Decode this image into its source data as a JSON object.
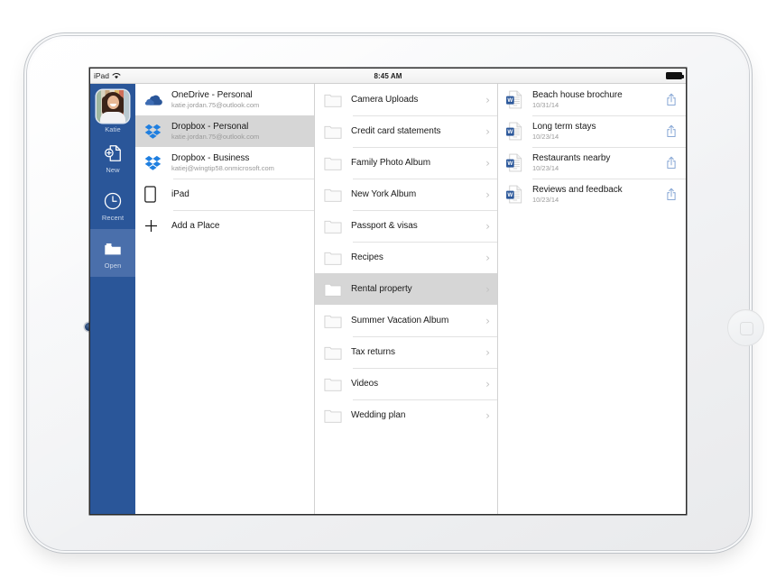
{
  "device": {
    "name": "ipad-landscape",
    "home_button": "home-button",
    "camera": "front-camera"
  },
  "statusbar": {
    "carrier": "iPad",
    "wifi_icon": "wifi-icon",
    "time": "8:45 AM",
    "battery_icon": "battery-full-icon"
  },
  "sidebar": {
    "accent": "#2a5699",
    "active_accent": "#4a6fab",
    "user": {
      "name": "Katie",
      "avatar": "user-avatar"
    },
    "items": [
      {
        "label": "New",
        "icon": "new-document-icon",
        "active": false
      },
      {
        "label": "Recent",
        "icon": "clock-icon",
        "active": false
      },
      {
        "label": "Open",
        "icon": "folder-open-icon",
        "active": true
      }
    ]
  },
  "places": {
    "items": [
      {
        "title": "OneDrive - Personal",
        "subtitle": "katie.jordan.75@outlook.com",
        "icon": "onedrive-icon",
        "selected": false
      },
      {
        "title": "Dropbox - Personal",
        "subtitle": "katie.jordan.75@outlook.com",
        "icon": "dropbox-icon",
        "selected": true
      },
      {
        "title": "Dropbox - Business",
        "subtitle": "katiej@wingtip58.onmicrosoft.com",
        "icon": "dropbox-icon",
        "selected": false
      },
      {
        "title": "iPad",
        "subtitle": "",
        "icon": "ipad-icon",
        "selected": false
      },
      {
        "title": "Add a Place",
        "subtitle": "",
        "icon": "plus-icon",
        "selected": false
      }
    ]
  },
  "folders": {
    "items": [
      {
        "title": "Camera Uploads",
        "selected": false
      },
      {
        "title": "Credit card statements",
        "selected": false
      },
      {
        "title": "Family Photo Album",
        "selected": false
      },
      {
        "title": "New York Album",
        "selected": false
      },
      {
        "title": "Passport & visas",
        "selected": false
      },
      {
        "title": "Recipes",
        "selected": false
      },
      {
        "title": "Rental property",
        "selected": true
      },
      {
        "title": "Summer Vacation Album",
        "selected": false
      },
      {
        "title": "Tax returns",
        "selected": false
      },
      {
        "title": "Videos",
        "selected": false
      },
      {
        "title": "Wedding plan",
        "selected": false
      }
    ]
  },
  "files": {
    "items": [
      {
        "title": "Beach house brochure",
        "date": "10/31/14",
        "type": "word-document"
      },
      {
        "title": "Long term stays",
        "date": "10/23/14",
        "type": "word-document"
      },
      {
        "title": "Restaurants nearby",
        "date": "10/23/14",
        "type": "word-document"
      },
      {
        "title": "Reviews and feedback",
        "date": "10/23/14",
        "type": "word-document"
      }
    ]
  },
  "colors": {
    "word_blue": "#2b579a",
    "dropbox_blue": "#1f7fe0",
    "onedrive_blue": "#2a5699",
    "share_blue": "#8aa9d6",
    "selection_gray": "#d6d6d6"
  }
}
